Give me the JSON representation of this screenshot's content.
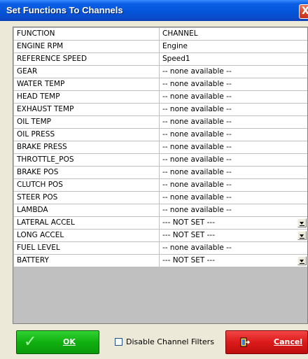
{
  "window": {
    "title": "Set Functions To Channels",
    "close_glyph": "X"
  },
  "table": {
    "headers": [
      "FUNCTION",
      "CHANNEL"
    ],
    "rows": [
      {
        "function": "ENGINE RPM",
        "channel": "Engine",
        "dropdown": false
      },
      {
        "function": "REFERENCE SPEED",
        "channel": "Speed1",
        "dropdown": false
      },
      {
        "function": "GEAR",
        "channel": "-- none available --",
        "dropdown": false
      },
      {
        "function": "WATER TEMP",
        "channel": "-- none available --",
        "dropdown": false
      },
      {
        "function": "HEAD TEMP",
        "channel": "-- none available --",
        "dropdown": false
      },
      {
        "function": "EXHAUST TEMP",
        "channel": "-- none available --",
        "dropdown": false
      },
      {
        "function": "OIL TEMP",
        "channel": "-- none available --",
        "dropdown": false
      },
      {
        "function": "OIL  PRESS",
        "channel": "-- none available --",
        "dropdown": false
      },
      {
        "function": "BRAKE PRESS",
        "channel": "-- none available --",
        "dropdown": false
      },
      {
        "function": "THROTTLE_POS",
        "channel": "-- none available --",
        "dropdown": false
      },
      {
        "function": "BRAKE POS",
        "channel": "-- none available --",
        "dropdown": false
      },
      {
        "function": "CLUTCH  POS",
        "channel": "-- none available --",
        "dropdown": false
      },
      {
        "function": "STEER POS",
        "channel": "-- none available --",
        "dropdown": false
      },
      {
        "function": "LAMBDA",
        "channel": "-- none available --",
        "dropdown": false
      },
      {
        "function": "LATERAL  ACCEL",
        "channel": "--- NOT SET ---",
        "dropdown": true
      },
      {
        "function": "LONG ACCEL",
        "channel": "--- NOT SET ---",
        "dropdown": true
      },
      {
        "function": "FUEL LEVEL",
        "channel": "-- none available --",
        "dropdown": false
      },
      {
        "function": "BATTERY",
        "channel": "--- NOT SET ---",
        "dropdown": true
      }
    ]
  },
  "buttons": {
    "ok_label": "OK",
    "ok_icon": "checkmark-icon",
    "cancel_label": "Cancel",
    "cancel_icon": "exit-door-icon"
  },
  "disable_filters": {
    "label": "Disable Channel Filters",
    "checked": false
  },
  "colors": {
    "title_bar": "#0454d8",
    "ok_button": "#10b010",
    "cancel_button": "#dc1a1a",
    "dialog_bg": "#ece9d8",
    "grid_bg": "#c0c0c0"
  }
}
